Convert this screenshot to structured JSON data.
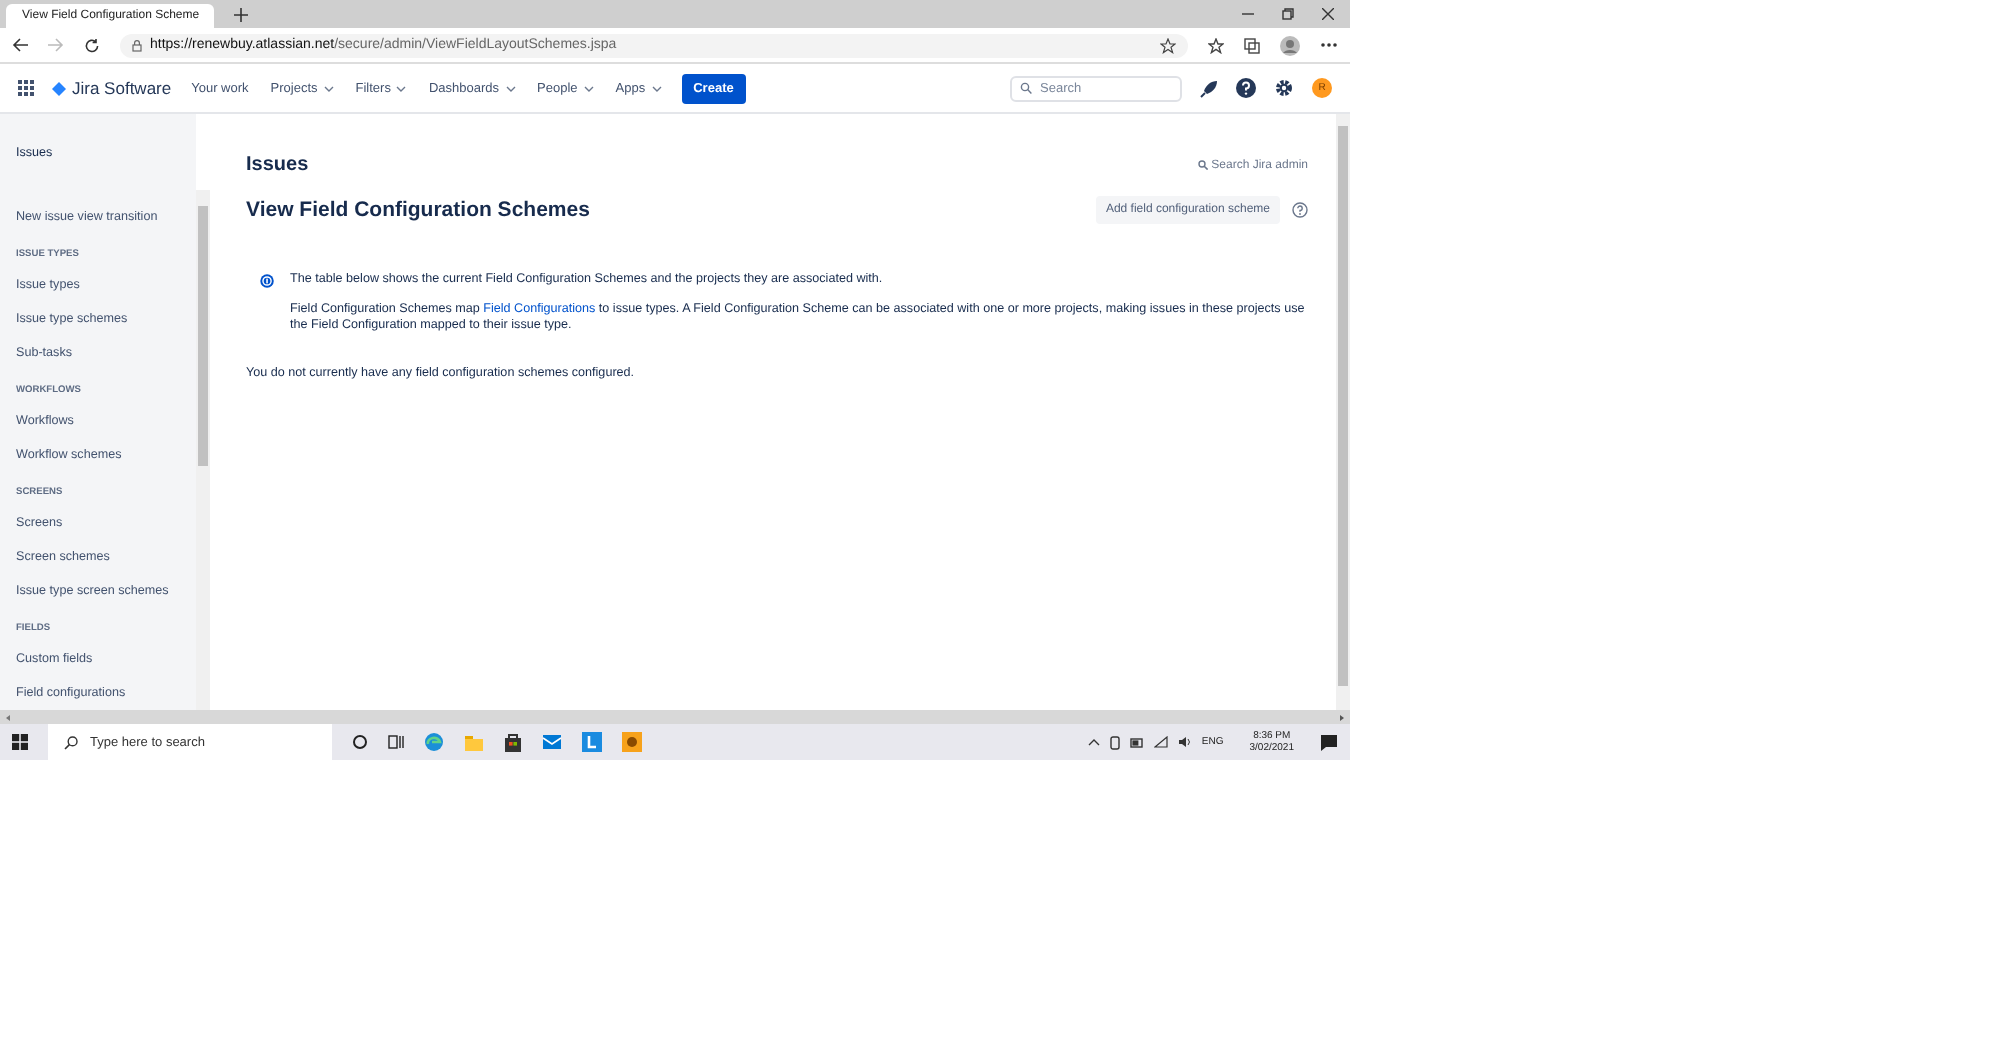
{
  "browser": {
    "tab_title": "View Field Configuration Scheme",
    "url_host": "https://renewbuy.atlassian.net",
    "url_path": "/secure/admin/ViewFieldLayoutSchemes.jspa"
  },
  "nav": {
    "app_name": "Jira Software",
    "items": [
      {
        "label": "Your work",
        "has_menu": false
      },
      {
        "label": "Projects",
        "has_menu": true
      },
      {
        "label": "Filters",
        "has_menu": true
      },
      {
        "label": "Dashboards",
        "has_menu": true
      },
      {
        "label": "People",
        "has_menu": true
      },
      {
        "label": "Apps",
        "has_menu": true
      }
    ],
    "create_button": "Create",
    "search": {
      "placeholder": "Search"
    },
    "avatar_initial": "R"
  },
  "sidebar": {
    "title": "Issues",
    "items": [
      {
        "kind": "link",
        "label": "New issue view transition"
      },
      {
        "kind": "section",
        "label": "ISSUE TYPES"
      },
      {
        "kind": "link",
        "label": "Issue types"
      },
      {
        "kind": "link",
        "label": "Issue type schemes"
      },
      {
        "kind": "link",
        "label": "Sub-tasks"
      },
      {
        "kind": "section",
        "label": "WORKFLOWS"
      },
      {
        "kind": "link",
        "label": "Workflows"
      },
      {
        "kind": "link",
        "label": "Workflow schemes"
      },
      {
        "kind": "section",
        "label": "SCREENS"
      },
      {
        "kind": "link",
        "label": "Screens"
      },
      {
        "kind": "link",
        "label": "Screen schemes"
      },
      {
        "kind": "link",
        "label": "Issue type screen schemes"
      },
      {
        "kind": "section",
        "label": "FIELDS"
      },
      {
        "kind": "link",
        "label": "Custom fields"
      },
      {
        "kind": "link",
        "label": "Field configurations"
      }
    ]
  },
  "page": {
    "section_title": "Issues",
    "search_admin": "Search Jira admin",
    "heading": "View Field Configuration Schemes",
    "add_button": "Add field configuration scheme",
    "info": {
      "line_1": "The table below shows the current Field Configuration Schemes and the projects they are associated with.",
      "line_2_before": "Field Configuration Schemes map ",
      "line_2_link": "Field Configurations",
      "line_2_after": " to issue types. A Field Configuration Scheme can be associated with one or more projects, making issues in these projects use the Field Configuration mapped to their issue type."
    },
    "empty_message": "You do not currently have any field configuration schemes configured."
  },
  "taskbar": {
    "search_placeholder": "Type here to search",
    "language": "ENG",
    "time": "8:36 PM",
    "date": "3/02/2021"
  }
}
